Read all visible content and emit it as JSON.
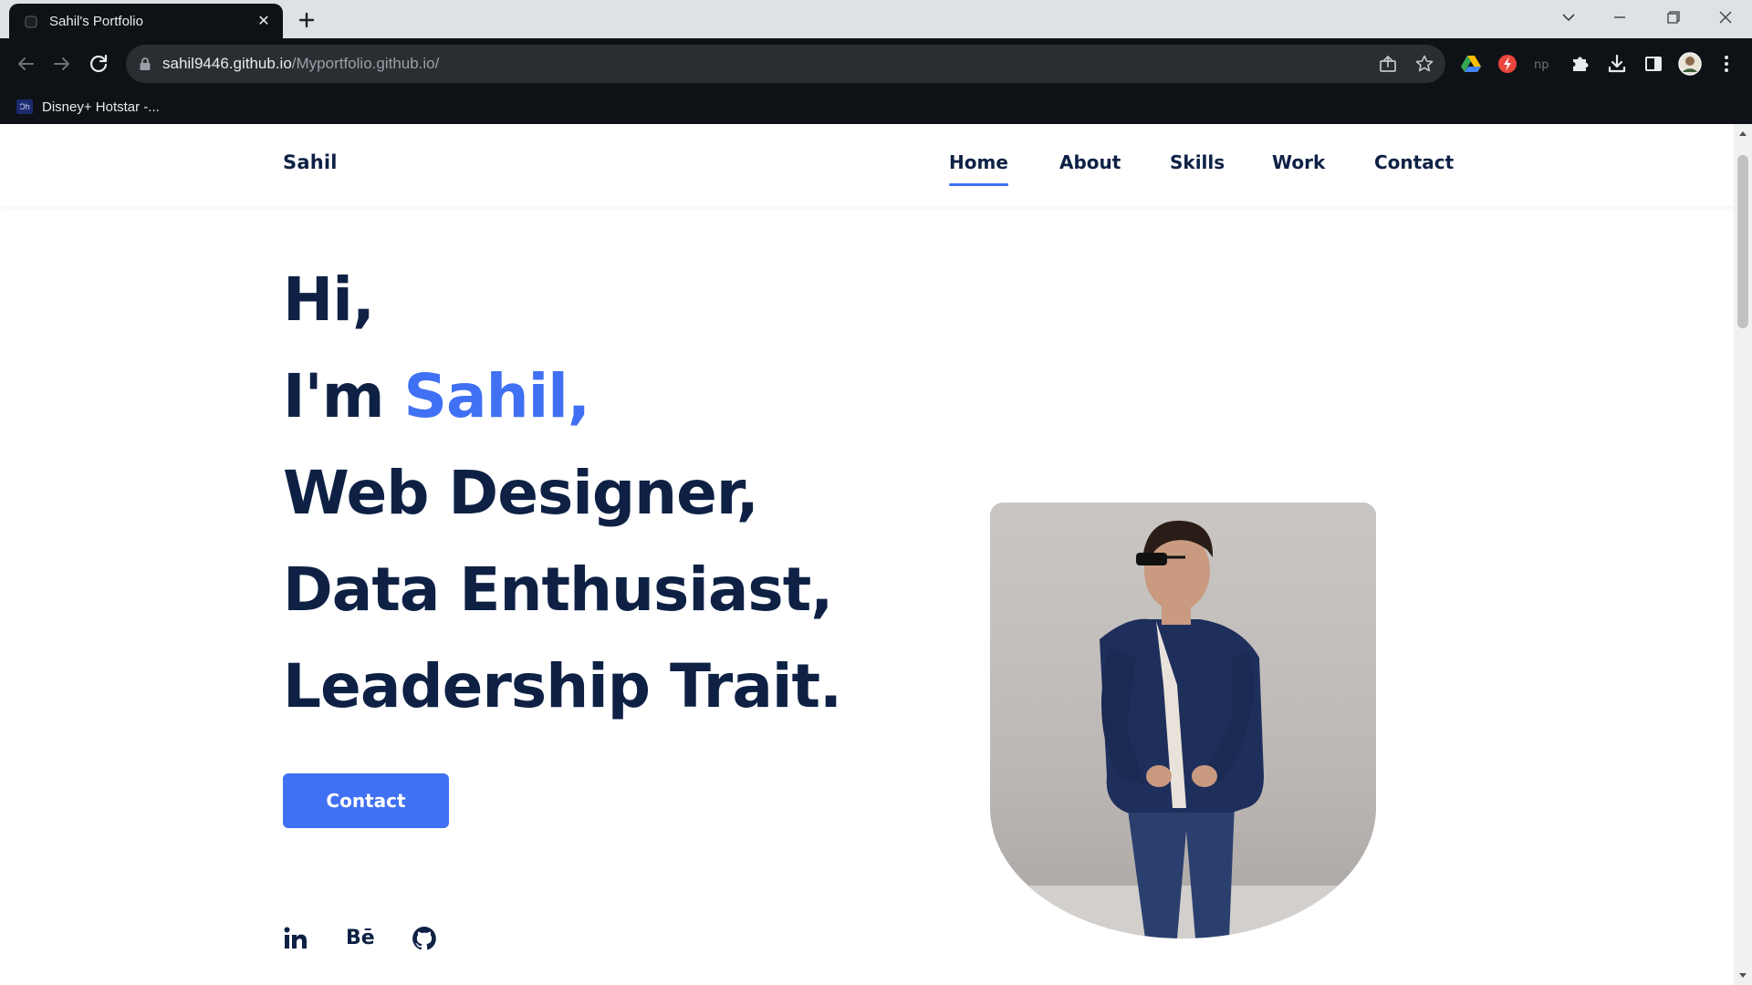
{
  "browser": {
    "tab_title": "Sahil's Portfolio",
    "url_host": "sahil9446.github.io",
    "url_path": "/Myportfolio.github.io/",
    "bookmark_label": "Disney+ Hotstar -...",
    "bookmark_icon_text": "Ɔh"
  },
  "site": {
    "logo": "Sahil",
    "nav": [
      "Home",
      "About",
      "Skills",
      "Work",
      "Contact"
    ],
    "active_nav": "Home",
    "hero": {
      "line1": "Hi,",
      "line2_prefix": "I'm ",
      "line2_name": "Sahil,",
      "line3": "Web Designer,",
      "line4": "Data Enthusiast,",
      "line5": "Leadership Trait."
    },
    "contact_button": "Contact",
    "social_icons": [
      "linkedin-icon",
      "behance-icon",
      "github-icon"
    ],
    "behance_text": "Bē"
  },
  "colors": {
    "accent": "#4070f4",
    "text_dark": "#0e2145",
    "chrome_dark": "#0e1217"
  }
}
